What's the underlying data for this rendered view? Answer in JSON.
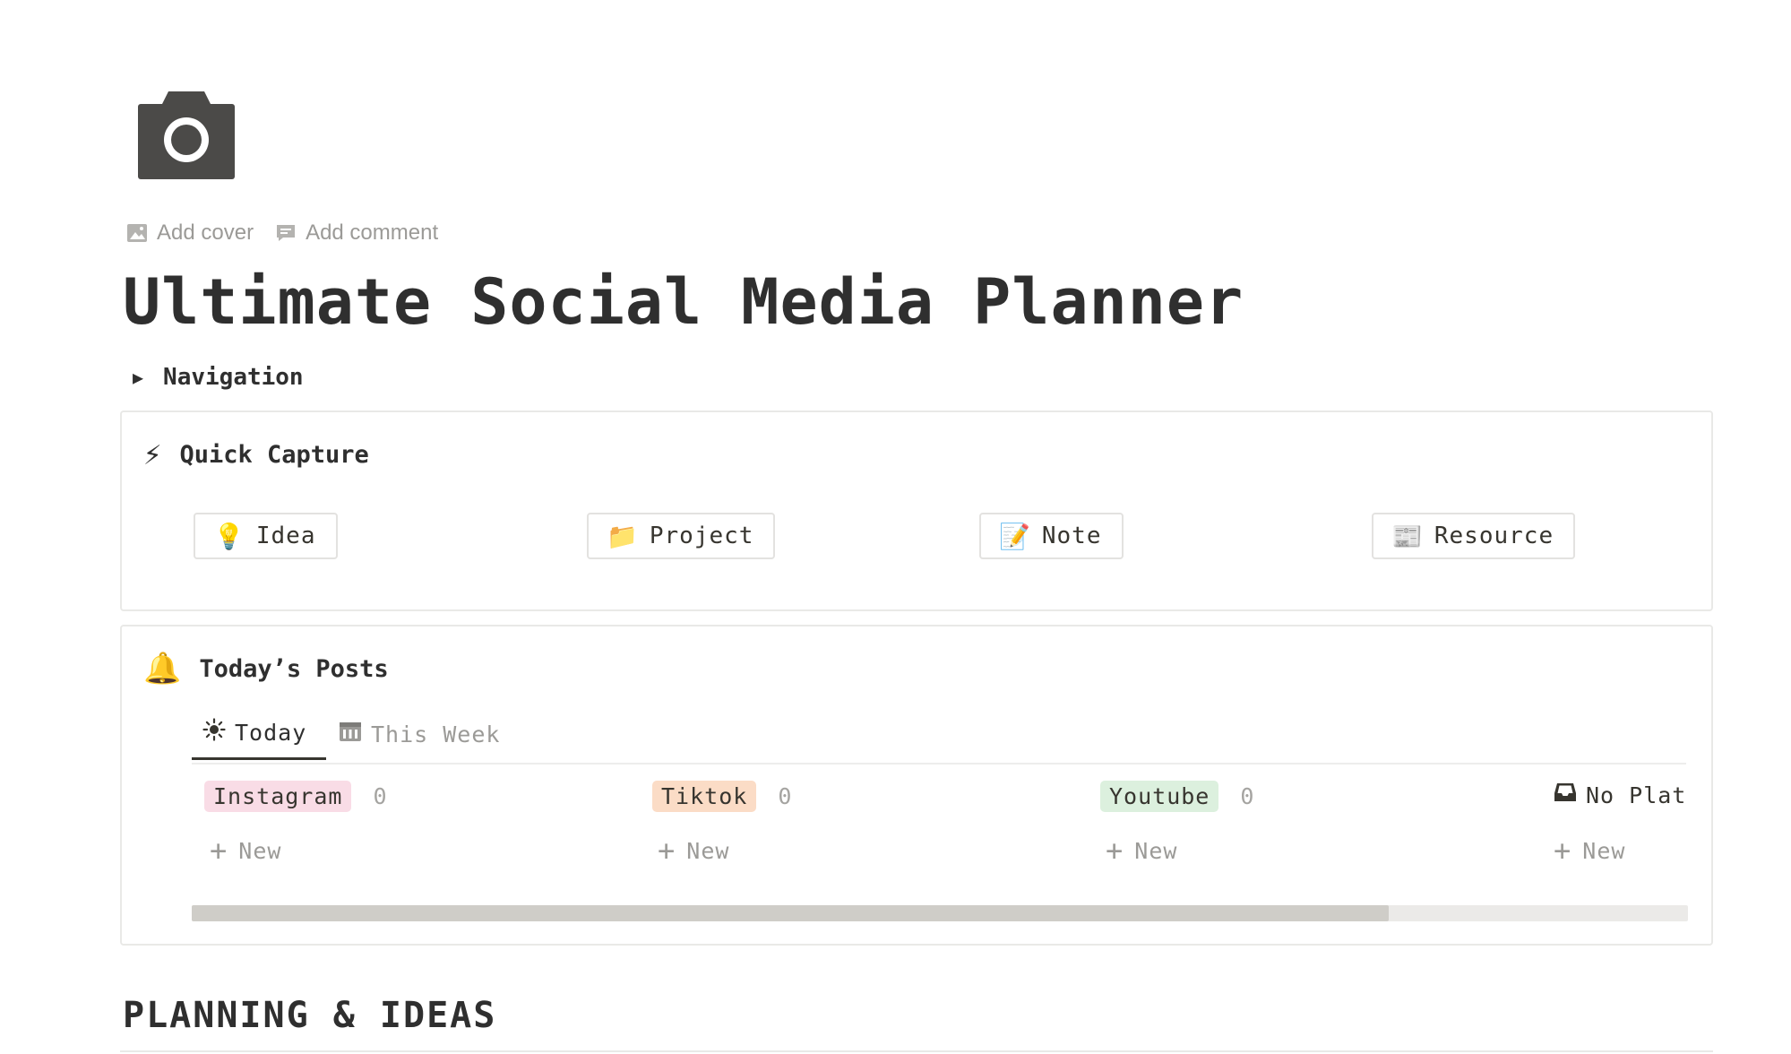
{
  "page": {
    "icon": "camera-icon",
    "actions": [
      {
        "label": "Add cover",
        "icon": "image-icon"
      },
      {
        "label": "Add comment",
        "icon": "comment-icon"
      }
    ],
    "title": "Ultimate Social Media Planner"
  },
  "navigation_toggle": {
    "label": "Navigation"
  },
  "quick_capture": {
    "emoji": "⚡",
    "title": "Quick Capture",
    "buttons": [
      {
        "emoji": "💡",
        "label": "Idea"
      },
      {
        "emoji": "📁",
        "label": "Project"
      },
      {
        "emoji": "📝",
        "label": "Note"
      },
      {
        "emoji": "📰",
        "label": "Resource"
      }
    ]
  },
  "todays_posts": {
    "emoji": "🔔",
    "title": "Today’s Posts",
    "tabs": [
      {
        "icon": "sun-icon",
        "label": "Today",
        "active": true
      },
      {
        "icon": "calendar-icon",
        "label": "This Week",
        "active": false
      }
    ],
    "columns": [
      {
        "label": "Instagram",
        "count": "0",
        "color": "#f9dce6"
      },
      {
        "label": "Tiktok",
        "count": "0",
        "color": "#fbdcc6"
      },
      {
        "label": "Youtube",
        "count": "0",
        "color": "#dcf0de"
      },
      {
        "label": "No Plat",
        "icon": "inbox-icon"
      }
    ],
    "new_label": "New",
    "scroll_position": 0.8
  },
  "section": {
    "title": "PLANNING & IDEAS"
  }
}
